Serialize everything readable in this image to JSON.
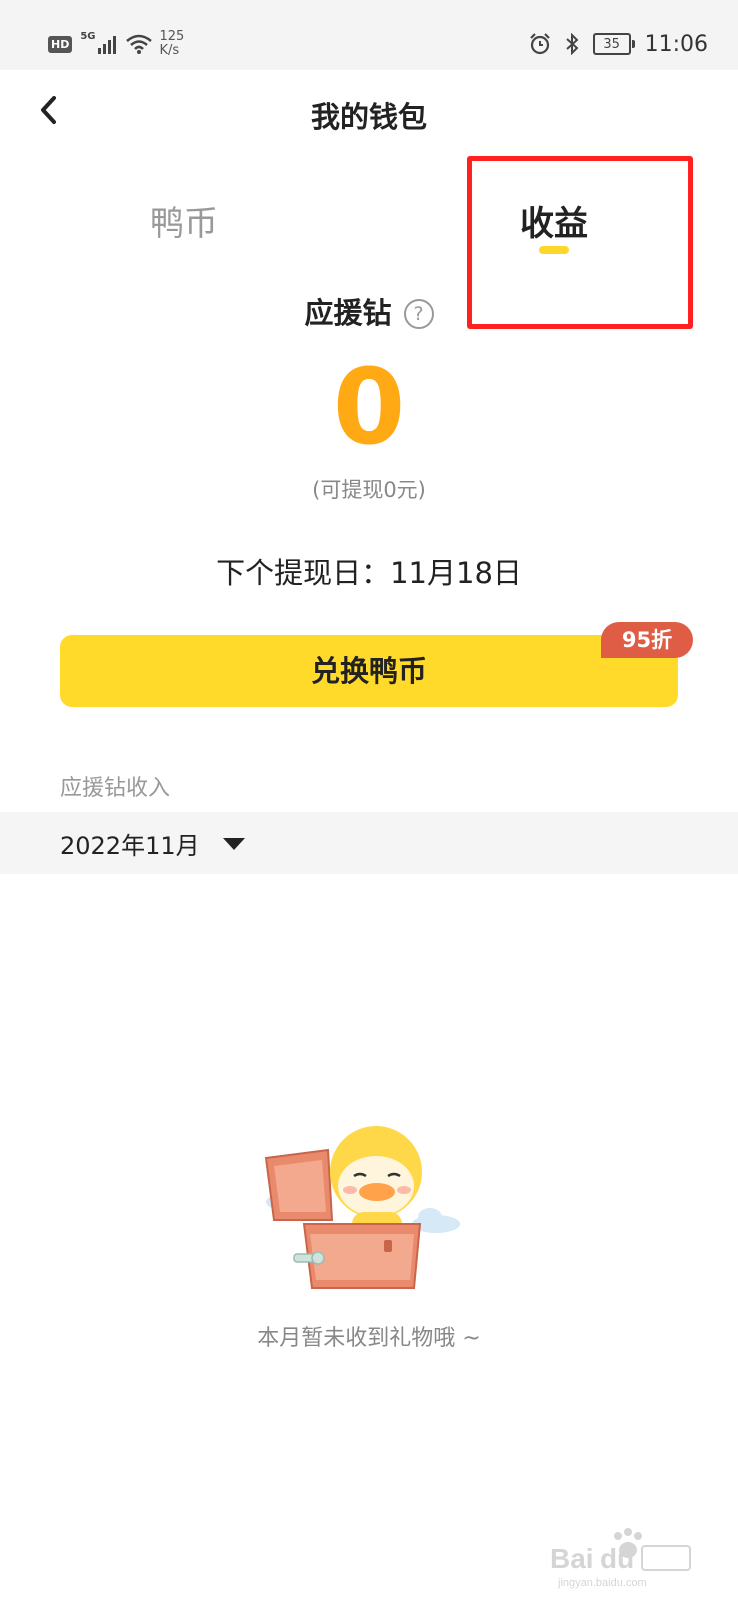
{
  "status_bar": {
    "hd": "HD",
    "network": "5G",
    "speed_value": "125",
    "speed_unit": "K/s",
    "battery": "35",
    "time": "11:06",
    "icons": [
      "signal-icon",
      "wifi-icon",
      "alarm-icon",
      "bluetooth-icon",
      "battery-icon"
    ]
  },
  "header": {
    "title": "我的钱包",
    "back_icon": "chevron-left-icon"
  },
  "tabs": [
    {
      "label": "鸭币",
      "active": false
    },
    {
      "label": "收益",
      "active": true
    }
  ],
  "balance": {
    "label": "应援钻",
    "help_glyph": "?",
    "amount": "0",
    "withdrawable": "(可提现0元)",
    "next_withdraw": "下个提现日：11月18日"
  },
  "exchange": {
    "button_label": "兑换鸭币",
    "badge": "95折"
  },
  "income": {
    "section_label": "应援钻收入",
    "month": "2022年11月"
  },
  "empty_state": {
    "message": "本月暂未收到礼物哦 ~"
  },
  "colors": {
    "accent_yellow": "#ffda2b",
    "balance_orange": "#ffaa14",
    "badge_red": "#e05d45",
    "highlight_red": "#ff2020"
  }
}
